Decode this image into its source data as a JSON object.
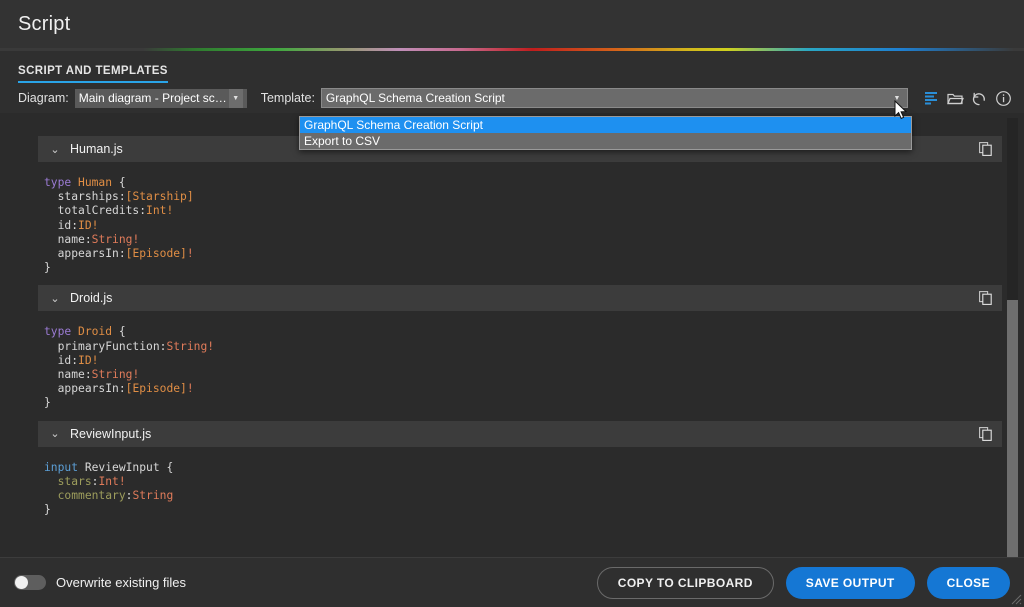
{
  "window": {
    "title": "Script"
  },
  "tabs": [
    {
      "label": "SCRIPT AND TEMPLATES",
      "active": true
    }
  ],
  "accent_color": "#2aa4e8",
  "selectors": {
    "diagram_label": "Diagram:",
    "diagram_value": "Main diagram - Project script",
    "template_label": "Template:",
    "template_value": "GraphQL Schema Creation Script"
  },
  "toolbar_icons": [
    {
      "name": "script-lines-icon",
      "title": "Edit script"
    },
    {
      "name": "folder-open-icon",
      "title": "Open"
    },
    {
      "name": "undo-icon",
      "title": "Reset"
    },
    {
      "name": "info-icon",
      "title": "Info"
    }
  ],
  "dropdown": {
    "open": true,
    "options": [
      {
        "label": "GraphQL Schema Creation Script",
        "selected": true
      },
      {
        "label": "Export to CSV",
        "selected": false
      }
    ],
    "highlight_color": "#1e90f0"
  },
  "files": [
    {
      "name": "Human.js",
      "expanded": true,
      "copy_icon": "copy-icon",
      "lines": [
        [
          {
            "t": "type",
            "c": "kw"
          },
          {
            "t": " ",
            "c": "plain"
          },
          {
            "t": "Human",
            "c": "typ"
          },
          {
            "t": " {",
            "c": "punct"
          }
        ],
        [
          {
            "t": "  ",
            "c": "plain"
          },
          {
            "t": "starships",
            "c": "fld"
          },
          {
            "t": ":",
            "c": "punct"
          },
          {
            "t": "[Starship]",
            "c": "typ"
          }
        ],
        [
          {
            "t": "  ",
            "c": "plain"
          },
          {
            "t": "totalCredits",
            "c": "fld"
          },
          {
            "t": ":",
            "c": "punct"
          },
          {
            "t": "Int!",
            "c": "typ"
          }
        ],
        [
          {
            "t": "  ",
            "c": "plain"
          },
          {
            "t": "id",
            "c": "fld"
          },
          {
            "t": ":",
            "c": "punct"
          },
          {
            "t": "ID!",
            "c": "typ"
          }
        ],
        [
          {
            "t": "  ",
            "c": "plain"
          },
          {
            "t": "name",
            "c": "fld"
          },
          {
            "t": ":",
            "c": "punct"
          },
          {
            "t": "String!",
            "c": "scal"
          }
        ],
        [
          {
            "t": "  ",
            "c": "plain"
          },
          {
            "t": "appearsIn",
            "c": "fld"
          },
          {
            "t": ":",
            "c": "punct"
          },
          {
            "t": "[Episode]",
            "c": "typ"
          },
          {
            "t": "!",
            "c": "scal"
          }
        ],
        [
          {
            "t": "}",
            "c": "punct"
          }
        ]
      ]
    },
    {
      "name": "Droid.js",
      "expanded": true,
      "copy_icon": "copy-icon",
      "lines": [
        [
          {
            "t": "type",
            "c": "kw"
          },
          {
            "t": " ",
            "c": "plain"
          },
          {
            "t": "Droid",
            "c": "typ"
          },
          {
            "t": " {",
            "c": "punct"
          }
        ],
        [
          {
            "t": "  ",
            "c": "plain"
          },
          {
            "t": "primaryFunction",
            "c": "fld"
          },
          {
            "t": ":",
            "c": "punct"
          },
          {
            "t": "String!",
            "c": "scal"
          }
        ],
        [
          {
            "t": "  ",
            "c": "plain"
          },
          {
            "t": "id",
            "c": "fld"
          },
          {
            "t": ":",
            "c": "punct"
          },
          {
            "t": "ID!",
            "c": "typ"
          }
        ],
        [
          {
            "t": "  ",
            "c": "plain"
          },
          {
            "t": "name",
            "c": "fld"
          },
          {
            "t": ":",
            "c": "punct"
          },
          {
            "t": "String!",
            "c": "scal"
          }
        ],
        [
          {
            "t": "  ",
            "c": "plain"
          },
          {
            "t": "appearsIn",
            "c": "fld"
          },
          {
            "t": ":",
            "c": "punct"
          },
          {
            "t": "[Episode]",
            "c": "typ"
          },
          {
            "t": "!",
            "c": "scal"
          }
        ],
        [
          {
            "t": "}",
            "c": "punct"
          }
        ]
      ]
    },
    {
      "name": "ReviewInput.js",
      "expanded": true,
      "copy_icon": "copy-icon",
      "lines": [
        [
          {
            "t": "input",
            "c": "kw2"
          },
          {
            "t": " ",
            "c": "plain"
          },
          {
            "t": "ReviewInput",
            "c": "plain"
          },
          {
            "t": " {",
            "c": "punct"
          }
        ],
        [
          {
            "t": "  ",
            "c": "plain"
          },
          {
            "t": "stars",
            "c": "fld2"
          },
          {
            "t": ":",
            "c": "punct"
          },
          {
            "t": "Int!",
            "c": "scal"
          }
        ],
        [
          {
            "t": "  ",
            "c": "plain"
          },
          {
            "t": "commentary",
            "c": "fld2"
          },
          {
            "t": ":",
            "c": "punct"
          },
          {
            "t": "String",
            "c": "scal"
          }
        ],
        [
          {
            "t": "}",
            "c": "punct"
          }
        ]
      ]
    }
  ],
  "footer": {
    "overwrite_label": "Overwrite existing files",
    "overwrite_on": false,
    "buttons": [
      {
        "label": "COPY TO CLIPBOARD",
        "style": "ghost"
      },
      {
        "label": "SAVE OUTPUT",
        "style": "primary"
      },
      {
        "label": "CLOSE",
        "style": "primary"
      }
    ]
  }
}
